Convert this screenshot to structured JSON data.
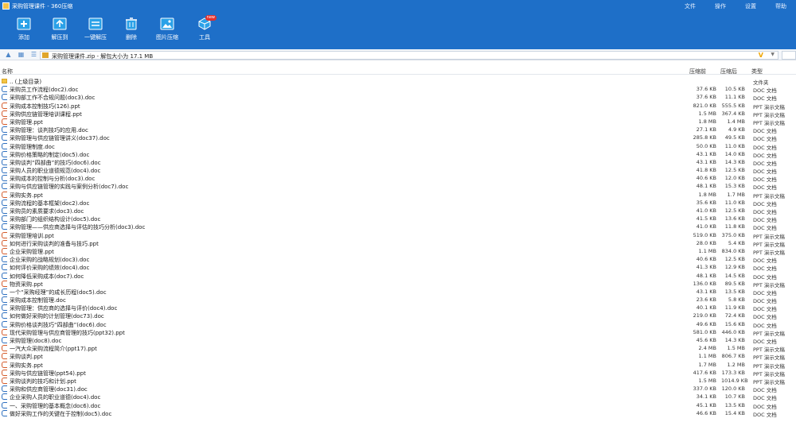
{
  "window": {
    "title": "采购管理课件 - 360压缩"
  },
  "menu": [
    "文件",
    "操作",
    "设置",
    "帮助"
  ],
  "toolbar": [
    {
      "label": "添加",
      "icon": "add-icon",
      "color": "#2aa1e8"
    },
    {
      "label": "解压到",
      "icon": "extract-icon",
      "color": "#2aa1e8"
    },
    {
      "label": "一键解压",
      "icon": "quick-extract-icon",
      "color": "#2aa1e8"
    },
    {
      "label": "删除",
      "icon": "trash-icon",
      "color": "#2aa1e8"
    },
    {
      "label": "图片压缩",
      "icon": "image-compress-icon",
      "color": "#2aa1e8"
    },
    {
      "label": "工具",
      "icon": "tools-icon",
      "color": "#2aa1e8",
      "badge": "new"
    }
  ],
  "address": {
    "path": "采购管理课件.zip - 解包大小为 17.1 MB"
  },
  "columns": {
    "name": "名称",
    "size": "压缩前",
    "packed": "压缩后",
    "type": "类型"
  },
  "files": [
    {
      "name": ".. (上级目录)",
      "kind": "up",
      "size": "",
      "packed": "",
      "type": "文件夹"
    },
    {
      "name": "采购员工作流程(doc2).doc",
      "kind": "doc",
      "size": "37.6 KB",
      "packed": "10.5 KB",
      "type": "DOC 文档"
    },
    {
      "name": "采购部工作不合规问题(doc3).doc",
      "kind": "doc",
      "size": "37.6 KB",
      "packed": "11.1 KB",
      "type": "DOC 文档"
    },
    {
      "name": "采购成本控制技巧(126).ppt",
      "kind": "ppt",
      "size": "821.0 KB",
      "packed": "555.5 KB",
      "type": "PPT 演示文稿"
    },
    {
      "name": "采购供应链管理培训课程.ppt",
      "kind": "ppt",
      "size": "1.5 MB",
      "packed": "367.4 KB",
      "type": "PPT 演示文稿"
    },
    {
      "name": "采购管理.ppt",
      "kind": "ppt",
      "size": "1.8 MB",
      "packed": "1.4 MB",
      "type": "PPT 演示文稿"
    },
    {
      "name": "采购管理：谈判技巧的应用.doc",
      "kind": "doc",
      "size": "27.1 KB",
      "packed": "4.9 KB",
      "type": "DOC 文档"
    },
    {
      "name": "采购管理与供应链管理讲义(doc37).doc",
      "kind": "doc",
      "size": "285.8 KB",
      "packed": "49.5 KB",
      "type": "DOC 文档"
    },
    {
      "name": "采购管理制度.doc",
      "kind": "doc",
      "size": "50.0 KB",
      "packed": "11.0 KB",
      "type": "DOC 文档"
    },
    {
      "name": "采购价格策略的制定(doc5).doc",
      "kind": "doc",
      "size": "43.1 KB",
      "packed": "14.0 KB",
      "type": "DOC 文档"
    },
    {
      "name": "采购谈判“四部曲”的技巧(doc6).doc",
      "kind": "doc",
      "size": "43.1 KB",
      "packed": "14.3 KB",
      "type": "DOC 文档"
    },
    {
      "name": "采购人员的职业道德规范(doc4).doc",
      "kind": "doc",
      "size": "41.8 KB",
      "packed": "12.5 KB",
      "type": "DOC 文档"
    },
    {
      "name": "采购成本的控制与分析(doc3).doc",
      "kind": "doc",
      "size": "40.6 KB",
      "packed": "12.0 KB",
      "type": "DOC 文档"
    },
    {
      "name": "采购与供应链管理的实践与案例分析(doc7).doc",
      "kind": "doc",
      "size": "48.1 KB",
      "packed": "15.3 KB",
      "type": "DOC 文档"
    },
    {
      "name": "采购实务.ppt",
      "kind": "ppt",
      "size": "1.8 MB",
      "packed": "1.7 MB",
      "type": "PPT 演示文稿"
    },
    {
      "name": "采购流程的基本框架(doc2).doc",
      "kind": "doc",
      "size": "35.6 KB",
      "packed": "11.0 KB",
      "type": "DOC 文档"
    },
    {
      "name": "采购员的素质要求(doc3).doc",
      "kind": "doc",
      "size": "41.0 KB",
      "packed": "12.5 KB",
      "type": "DOC 文档"
    },
    {
      "name": "采购部门的组织结构设计(doc5).doc",
      "kind": "doc",
      "size": "41.5 KB",
      "packed": "13.6 KB",
      "type": "DOC 文档"
    },
    {
      "name": "采购管理——供应商选择与评估的技巧分析(doc3).doc",
      "kind": "doc",
      "size": "41.0 KB",
      "packed": "11.8 KB",
      "type": "DOC 文档"
    },
    {
      "name": "采购管理培训.ppt",
      "kind": "ppt",
      "size": "519.0 KB",
      "packed": "375.0 KB",
      "type": "PPT 演示文稿"
    },
    {
      "name": "如何进行采购谈判的准备与技巧.ppt",
      "kind": "ppt",
      "size": "28.0 KB",
      "packed": "5.4 KB",
      "type": "PPT 演示文稿"
    },
    {
      "name": "企业采购管理.ppt",
      "kind": "ppt",
      "size": "1.1 MB",
      "packed": "834.0 KB",
      "type": "PPT 演示文稿"
    },
    {
      "name": "企业采购的战略规划(doc3).doc",
      "kind": "doc",
      "size": "40.6 KB",
      "packed": "12.5 KB",
      "type": "DOC 文档"
    },
    {
      "name": "如何评价采购的绩效(doc4).doc",
      "kind": "doc",
      "size": "41.3 KB",
      "packed": "12.9 KB",
      "type": "DOC 文档"
    },
    {
      "name": "如何降低采购成本(doc7).doc",
      "kind": "doc",
      "size": "48.1 KB",
      "packed": "14.5 KB",
      "type": "DOC 文档"
    },
    {
      "name": "物资采购.ppt",
      "kind": "ppt",
      "size": "136.0 KB",
      "packed": "89.5 KB",
      "type": "PPT 演示文稿"
    },
    {
      "name": "一个“采购经理”的成长历程(doc5).doc",
      "kind": "doc",
      "size": "43.1 KB",
      "packed": "13.5 KB",
      "type": "DOC 文档"
    },
    {
      "name": "采购成本控制管理.doc",
      "kind": "doc",
      "size": "23.6 KB",
      "packed": "5.8 KB",
      "type": "DOC 文档"
    },
    {
      "name": "采购管理：供应商的选择与评价(doc4).doc",
      "kind": "doc",
      "size": "40.1 KB",
      "packed": "11.9 KB",
      "type": "DOC 文档"
    },
    {
      "name": "如何做好采购的计划管理(doc73).doc",
      "kind": "doc",
      "size": "219.0 KB",
      "packed": "72.4 KB",
      "type": "DOC 文档"
    },
    {
      "name": "采购价格谈判技巧“四部曲”(doc6).doc",
      "kind": "doc",
      "size": "49.6 KB",
      "packed": "15.6 KB",
      "type": "DOC 文档"
    },
    {
      "name": "现代采购管理与供应商管理的技巧(ppt32).ppt",
      "kind": "ppt",
      "size": "581.0 KB",
      "packed": "446.0 KB",
      "type": "PPT 演示文稿"
    },
    {
      "name": "采购管理(doc8).doc",
      "kind": "doc",
      "size": "45.6 KB",
      "packed": "14.3 KB",
      "type": "DOC 文档"
    },
    {
      "name": "一汽大众采购流程简介(ppt17).ppt",
      "kind": "ppt",
      "size": "2.4 MB",
      "packed": "1.5 MB",
      "type": "PPT 演示文稿"
    },
    {
      "name": "采购谈判.ppt",
      "kind": "ppt",
      "size": "1.1 MB",
      "packed": "806.7 KB",
      "type": "PPT 演示文稿"
    },
    {
      "name": "采购实务.ppt",
      "kind": "ppt",
      "size": "1.7 MB",
      "packed": "1.2 MB",
      "type": "PPT 演示文稿"
    },
    {
      "name": "采购与供应链管理(ppt54).ppt",
      "kind": "ppt",
      "size": "417.6 KB",
      "packed": "173.3 KB",
      "type": "PPT 演示文稿"
    },
    {
      "name": "采购谈判的技巧和计划.ppt",
      "kind": "ppt",
      "size": "1.5 MB",
      "packed": "1014.9 KB",
      "type": "PPT 演示文稿"
    },
    {
      "name": "采购和供应商管理(doc31).doc",
      "kind": "doc",
      "size": "337.0 KB",
      "packed": "120.0 KB",
      "type": "DOC 文档"
    },
    {
      "name": "企业采购人员的职业道德(doc4).doc",
      "kind": "doc",
      "size": "34.1 KB",
      "packed": "10.7 KB",
      "type": "DOC 文档"
    },
    {
      "name": "一、采购管理的基本概念(doc6).doc",
      "kind": "doc",
      "size": "45.1 KB",
      "packed": "13.5 KB",
      "type": "DOC 文档"
    },
    {
      "name": "做好采购工作的关键在于控制(doc5).doc",
      "kind": "doc",
      "size": "46.6 KB",
      "packed": "15.4 KB",
      "type": "DOC 文档"
    }
  ]
}
